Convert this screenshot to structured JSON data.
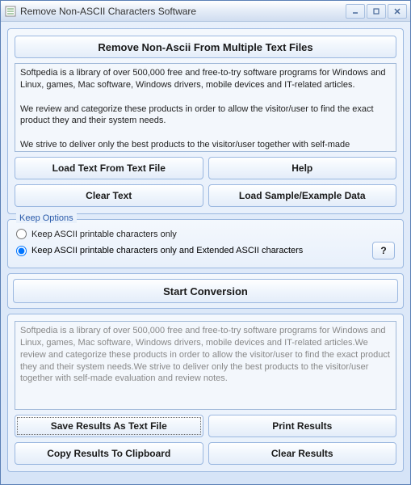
{
  "window": {
    "title": "Remove Non-ASCII Characters Software"
  },
  "header": {
    "title": "Remove Non-Ascii From Multiple Text Files"
  },
  "input_text": "Softpedia is a library of over 500,000 free and free-to-try software programs for Windows and Linux, games, Mac software, Windows drivers, mobile devices and IT-related articles.\n\nWe review and categorize these products in order to allow the visitor/user to find the exact product they and their system needs.\n\nWe strive to deliver only the best products to the visitor/user together with self-made evaluation and review notes.",
  "buttons": {
    "load_text": "Load Text From Text File",
    "help": "Help",
    "clear_text": "Clear Text",
    "load_sample": "Load Sample/Example Data",
    "question": "?",
    "start": "Start Conversion",
    "save_results": "Save Results As Text File",
    "print_results": "Print Results",
    "copy_results": "Copy Results To Clipboard",
    "clear_results": "Clear Results"
  },
  "options": {
    "legend": "Keep Options",
    "radio1": "Keep ASCII printable characters only",
    "radio2": "Keep ASCII printable characters only and Extended ASCII characters",
    "selected": "radio2"
  },
  "output_text": "Softpedia is a library of over 500,000 free and free-to-try software programs for Windows and Linux, games, Mac software, Windows drivers, mobile devices and IT-related articles.We review and categorize these products in order to allow the visitor/user to find the exact product they and their system needs.We strive to deliver only the best products to the visitor/user together with self-made evaluation and review notes."
}
